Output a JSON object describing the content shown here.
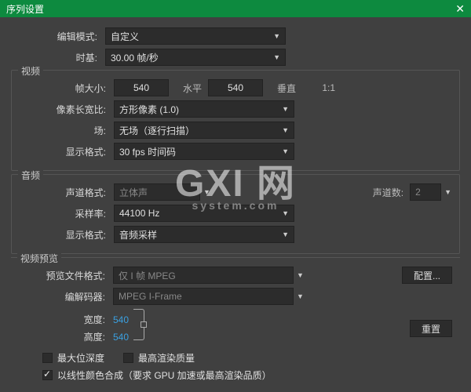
{
  "title": "序列设置",
  "top": {
    "editModeLabel": "编辑模式:",
    "editModeValue": "自定义",
    "timebaseLabel": "时基:",
    "timebaseValue": "30.00 帧/秒"
  },
  "video": {
    "legend": "视频",
    "frameSizeLabel": "帧大小:",
    "frameW": "540",
    "horiz": "水平",
    "frameH": "540",
    "vert": "垂直",
    "aspect": "1:1",
    "parLabel": "像素长宽比:",
    "parValue": "方形像素 (1.0)",
    "fieldsLabel": "场:",
    "fieldsValue": "无场（逐行扫描）",
    "displayFormatLabel": "显示格式:",
    "displayFormatValue": "30 fps 时间码"
  },
  "audio": {
    "legend": "音频",
    "channelFormatLabel": "声道格式:",
    "channelFormatValue": "立体声",
    "channelsLabel": "声道数:",
    "channelsValue": "2",
    "sampleRateLabel": "采样率:",
    "sampleRateValue": "44100 Hz",
    "displayFormatLabel": "显示格式:",
    "displayFormatValue": "音频采样"
  },
  "preview": {
    "legend": "视频预览",
    "fileFormatLabel": "预览文件格式:",
    "fileFormatValue": "仅 I 帧 MPEG",
    "configure": "配置...",
    "codecLabel": "编解码器:",
    "codecValue": "MPEG I-Frame",
    "widthLabel": "宽度:",
    "widthValue": "540",
    "heightLabel": "高度:",
    "heightValue": "540",
    "reset": "重置",
    "maxBitDepth": "最大位深度",
    "maxRenderQuality": "最高渲染质量",
    "linearColor": "以线性颜色合成（要求 GPU 加速或最高渲染品质）"
  },
  "watermark": {
    "main": "GXI 网",
    "sub": "system.com"
  }
}
